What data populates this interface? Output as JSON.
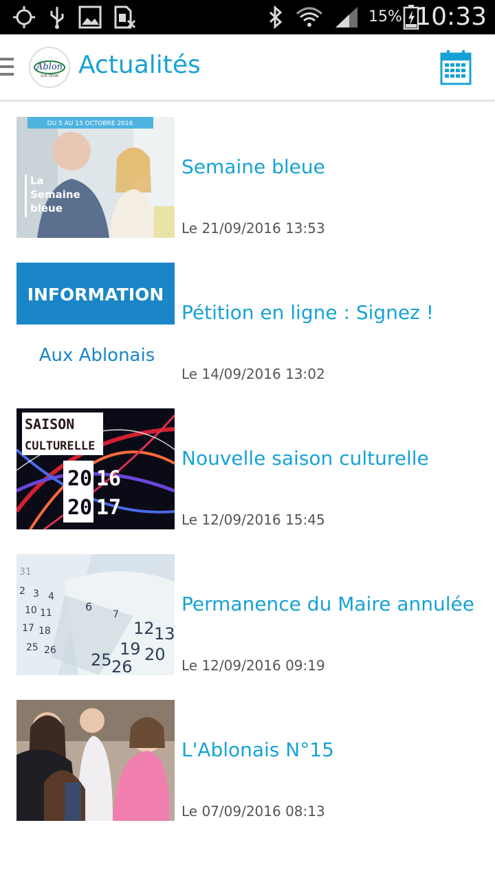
{
  "status_bar": {
    "battery_percent": "15%",
    "time": "10:33",
    "icons": [
      "gps-icon",
      "usb-icon",
      "image-icon",
      "sim-icon",
      "bluetooth-icon",
      "wifi-icon",
      "signal-icon",
      "battery-icon"
    ]
  },
  "app_bar": {
    "title": "Actualités",
    "logo_text": "Ablon",
    "logo_subtext": "SUR SEINE",
    "menu_icon": "hamburger-menu-icon",
    "calendar_icon": "calendar-icon"
  },
  "news": [
    {
      "title": "Semaine bleue",
      "date": "Le 21/09/2016 13:53",
      "thumb": {
        "banner": "DU 5 AU 13 OCTOBRE 2016",
        "line1": "La",
        "line2": "Semaine",
        "line3": "bleue"
      }
    },
    {
      "title": "Pétition en ligne : Signez !",
      "date": "Le 14/09/2016 13:02",
      "thumb": {
        "banner": "INFORMATION",
        "sub": "Aux Ablonais"
      }
    },
    {
      "title": "Nouvelle saison culturelle",
      "date": "Le 12/09/2016 15:45",
      "thumb": {
        "line1": "SAISON",
        "line2": "CULTURELLE",
        "year1a": "20",
        "year1b": "16",
        "year2a": "20",
        "year2b": "17"
      }
    },
    {
      "title": "Permanence du Maire annulée",
      "date": "Le 12/09/2016 09:19",
      "thumb": {}
    },
    {
      "title": "L'Ablonais N°15",
      "date": "Le 07/09/2016 08:13",
      "thumb": {}
    }
  ],
  "colors": {
    "accent": "#17a2d6",
    "info_banner": "#1a86c7",
    "date_text": "#555555"
  }
}
